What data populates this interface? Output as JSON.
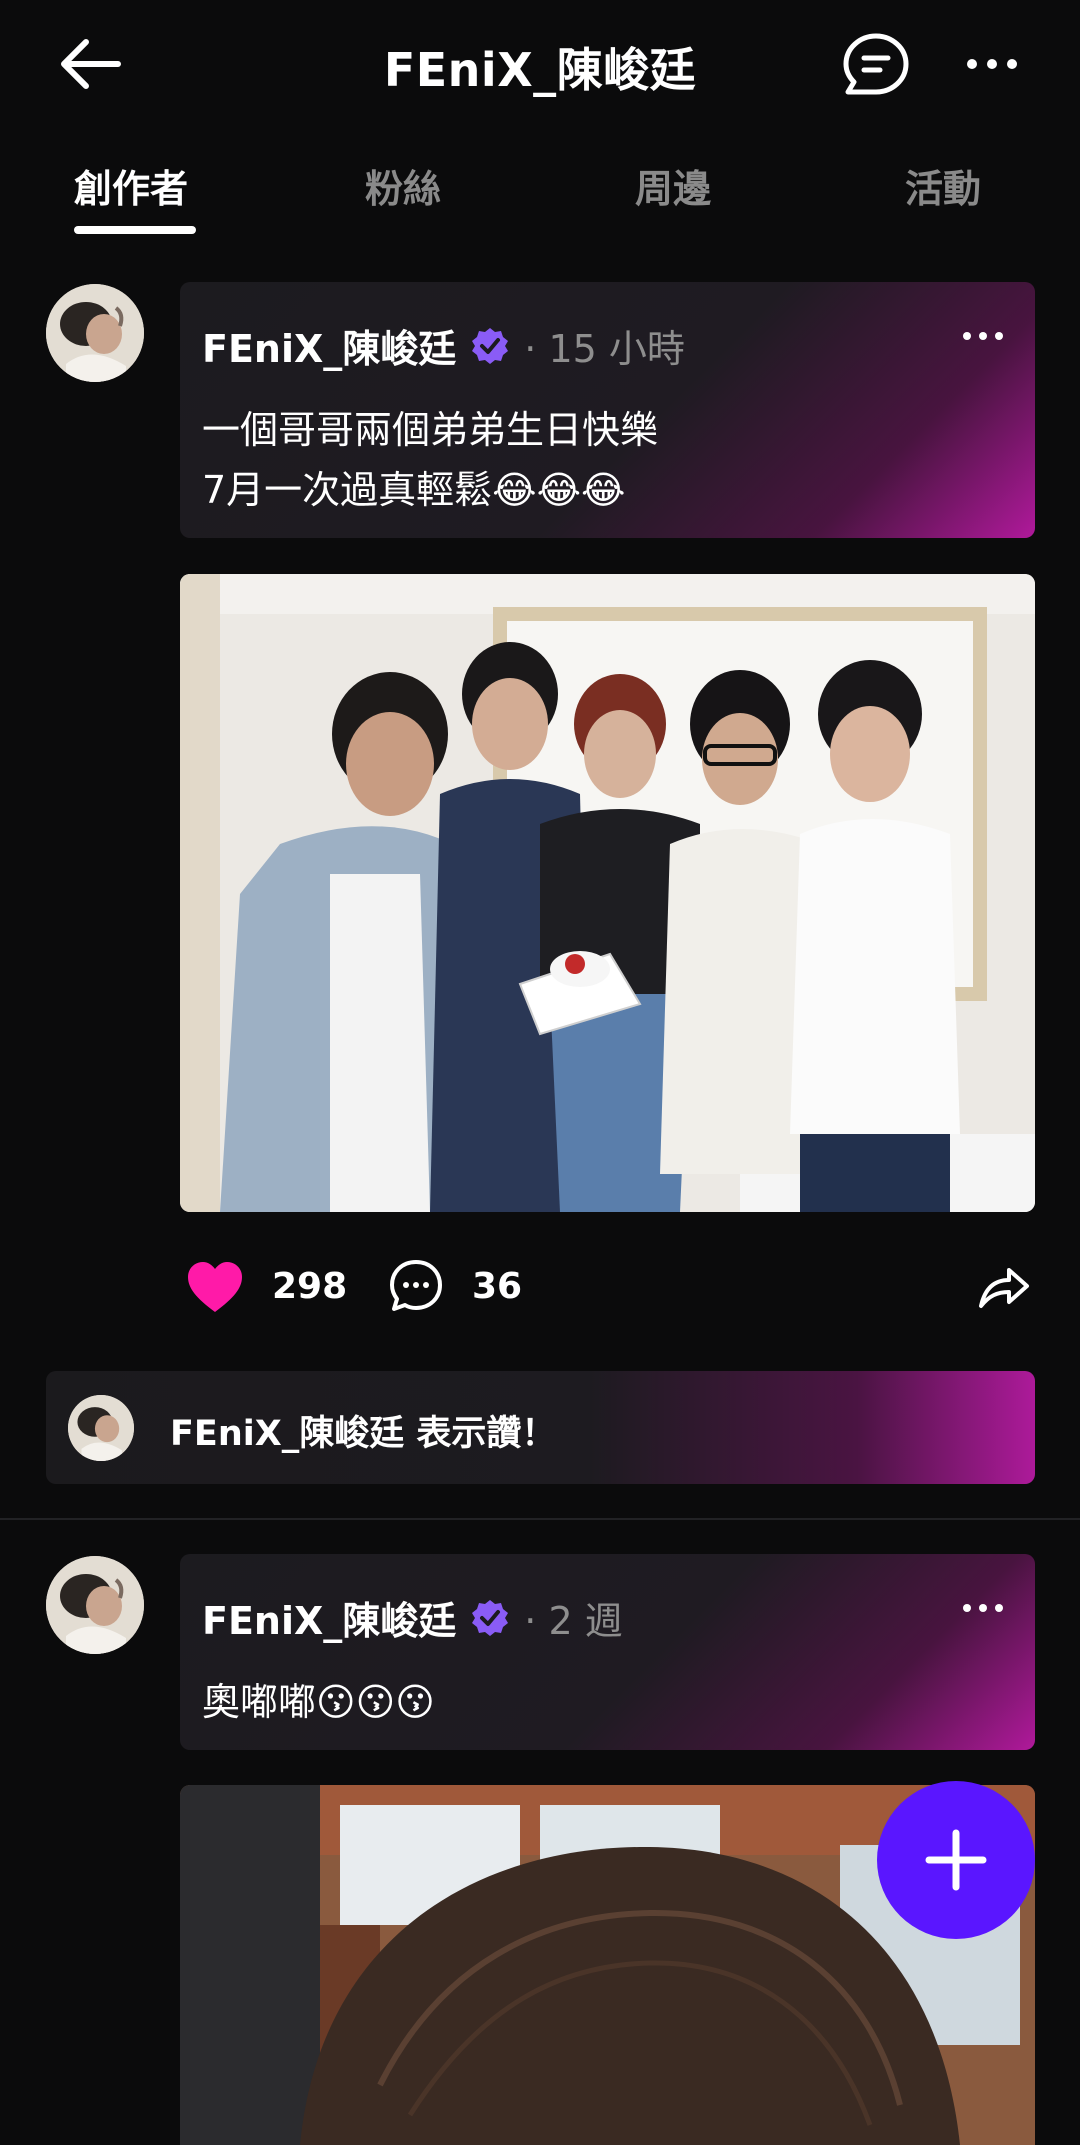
{
  "header": {
    "title": "FEniX_陳峻廷",
    "back_icon": "arrow-left-icon",
    "message_icon": "chat-bubble-icon",
    "more_icon": "more-horizontal-icon"
  },
  "tabs": [
    {
      "label": "創作者",
      "active": true
    },
    {
      "label": "粉絲",
      "active": false
    },
    {
      "label": "周邊",
      "active": false
    },
    {
      "label": "活動",
      "active": false
    }
  ],
  "posts": [
    {
      "author": "FEniX_陳峻廷",
      "verified": true,
      "time": "· 15 小時",
      "text": "一個哥哥兩個弟弟生日快樂\n7月一次過真輕鬆😂😂😂",
      "likes": "298",
      "comments": "36",
      "liked_by_text": "FEniX_陳峻廷  表示讚！"
    },
    {
      "author": "FEniX_陳峻廷",
      "verified": true,
      "time": "· 2 週",
      "text": "奧嘟嘟😗😗😗"
    }
  ],
  "colors": {
    "background": "#0b0b0c",
    "like": "#ff1aa8",
    "verified": "#8a5cf6",
    "fab": "#5a16ff",
    "card_gradient_end": "#b0199b"
  },
  "fab": {
    "icon": "plus-icon"
  }
}
